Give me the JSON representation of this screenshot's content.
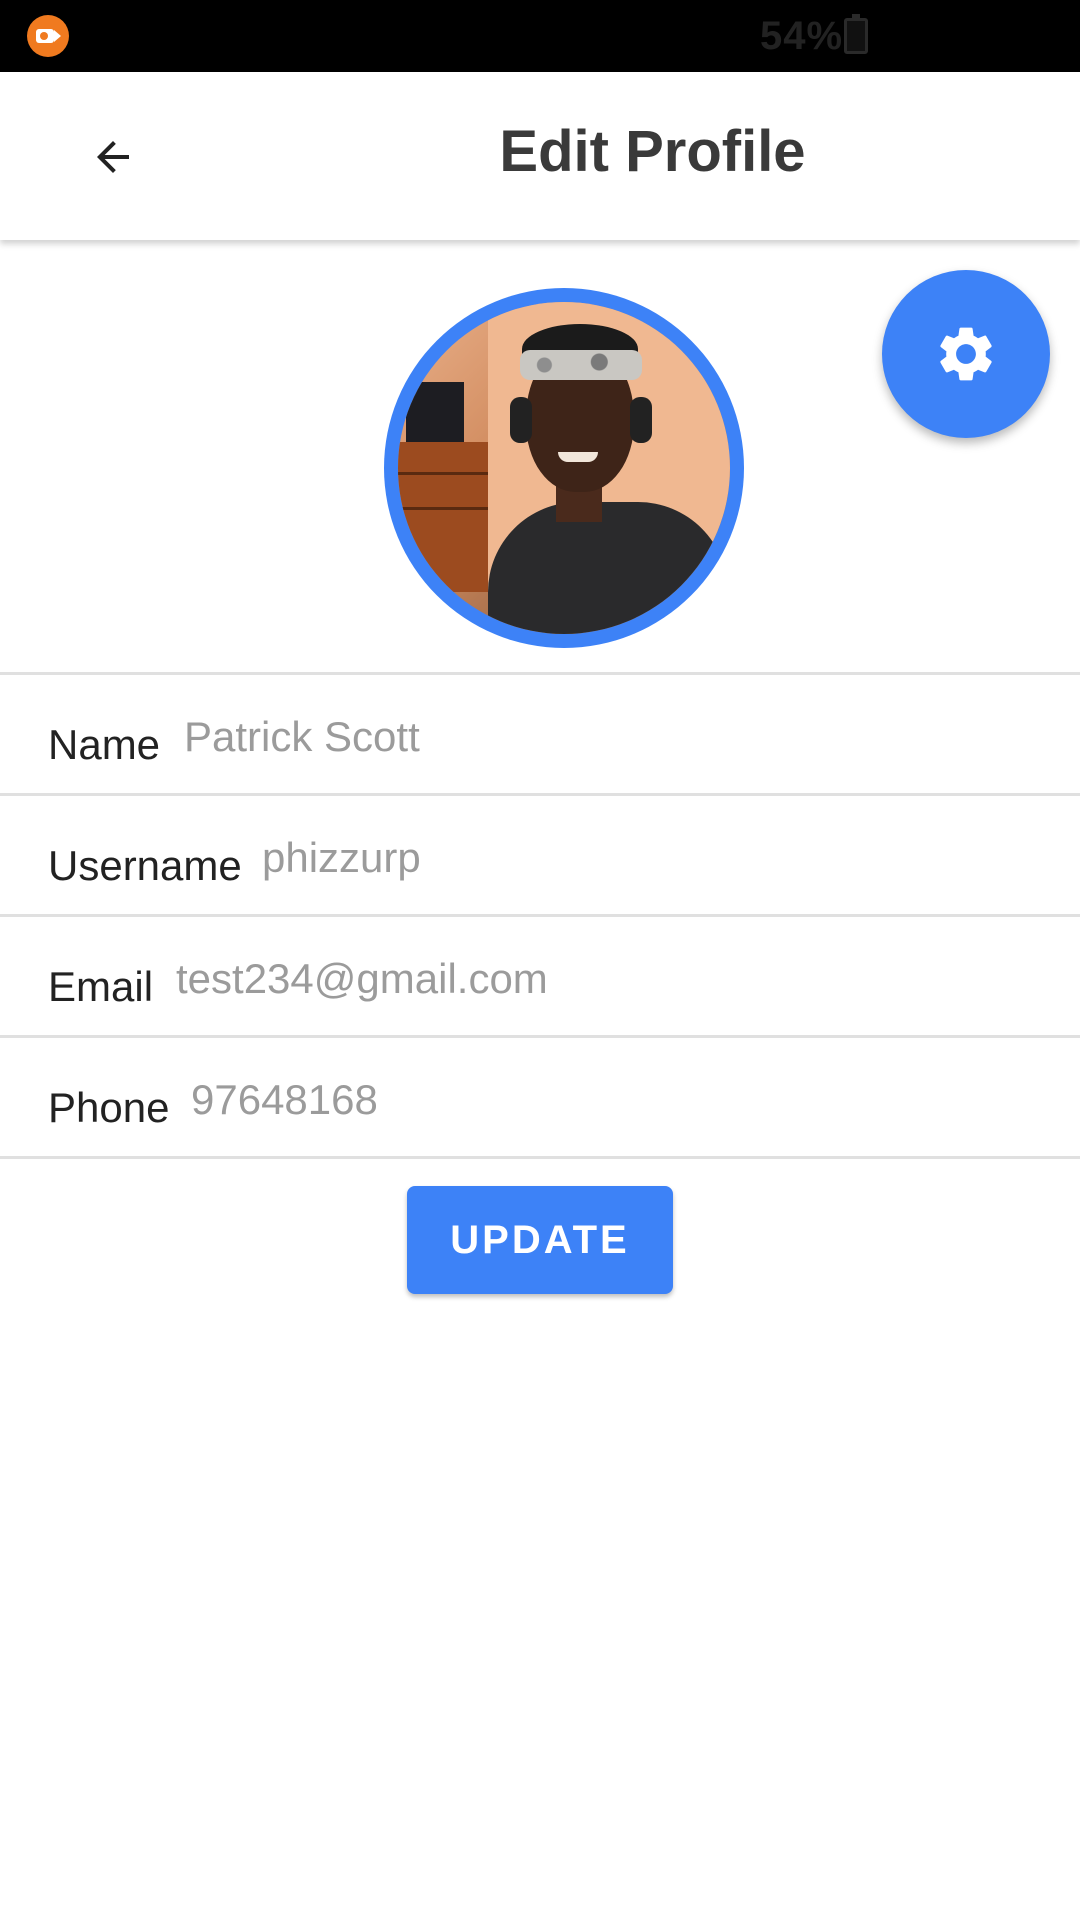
{
  "status_bar": {
    "battery_percent": "54%",
    "app_icon": "screen-recorder-icon"
  },
  "header": {
    "title": "Edit Profile",
    "back_icon": "arrow-left-icon"
  },
  "profile": {
    "avatar": "profile-photo",
    "settings_icon": "gear-icon"
  },
  "form": {
    "fields": [
      {
        "label": "Name",
        "value": "Patrick Scott"
      },
      {
        "label": "Username",
        "value": "phizzurp"
      },
      {
        "label": "Email",
        "value": "test234@gmail.com"
      },
      {
        "label": "Phone",
        "value": "97648168"
      }
    ],
    "submit_label": "UPDATE"
  },
  "colors": {
    "accent": "#3d82f7",
    "status_bar": "#000000",
    "value_text": "#9b9b9b",
    "label_text": "#222222"
  }
}
